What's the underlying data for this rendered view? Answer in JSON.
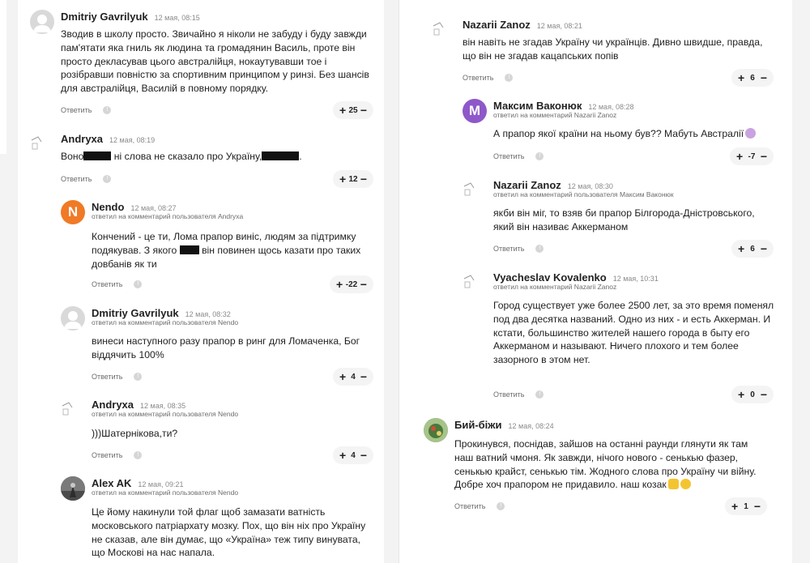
{
  "ui": {
    "reply_label": "Ответить"
  },
  "left": {
    "c1": {
      "author": "Dmitriy Gavrilyuk",
      "time": "12 мая, 08:15",
      "text": "Зводив в школу просто. Звичайно  я ніколи не забуду і буду завжди пам'ятати яка гниль як людина та громадянин Василь, проте він просто декласував цього австралійця, нокаутувавши тое і розібравши повністю за спортивним принципом у ринзі. Без шансів для австралійця, Василій в повному порядку.",
      "score": "25"
    },
    "c2": {
      "author": "Andryxa",
      "time": "12 мая, 08:19",
      "text_a": "Воно",
      "text_b": " ні слова не сказало про Україну,",
      "text_c": ".",
      "score": "12"
    },
    "c3": {
      "author": "Nendo",
      "time": "12 мая, 08:27",
      "reply_to": "ответил на комментарий пользователя Andryxa",
      "initial": "N",
      "text_a": "Кончений - це ти, Лома прапор виніс, людям за підтримку подякував. З якого ",
      "text_b": " він повинен щось казати про таких довбанів як ти",
      "score": "-22"
    },
    "c4": {
      "author": "Dmitriy Gavrilyuk",
      "time": "12 мая, 08:32",
      "reply_to": "ответил на комментарий пользователя Nendo",
      "text": "винеси наступного разу прапор в ринг для Ломаченка, Бог віддячить 100%",
      "score": "4"
    },
    "c5": {
      "author": "Andryxa",
      "time": "12 мая, 08:35",
      "reply_to": "ответил на комментарий пользователя Nendo",
      "text": ")))Шатернікова,ти?",
      "score": "4"
    },
    "c6": {
      "author": "Alex AK",
      "time": "12 мая, 09:21",
      "reply_to": "ответил на комментарий пользователя Nendo",
      "text": "Це йому накинули той флаг щоб замазати ватність московського патріархату мозку. Пох, що він ніх про Україну не сказав, але він думає, що «Україна» теж типу винувата, що Москові на нас напала."
    }
  },
  "right": {
    "r1": {
      "author": "Nazarii Zanoz",
      "time": "12 мая, 08:21",
      "text": "він навіть не згадав Україну чи українців. Дивно швидше, правда, що він не згадав кацапських попів",
      "score": "6"
    },
    "r2": {
      "author": "Максим Ваконюк",
      "time": "12 мая, 08:28",
      "reply_to": "ответил на комментарий Nazarii Zanoz",
      "initial": "М",
      "text": "А прапор якої країни на ньому був?? Мабуть Австралії",
      "score": "-7"
    },
    "r3": {
      "author": "Nazarii Zanoz",
      "time": "12 мая, 08:30",
      "reply_to": "ответил на комментарий пользователя Максим Ваконюк",
      "text": "якби він міг, то взяв би прапор Білгорода-Дністровського, який він називає Аккерманом",
      "score": "6"
    },
    "r4": {
      "author": "Vyacheslav Kovalenko",
      "time": "12 мая, 10:31",
      "reply_to": "ответил на комментарий Nazarii Zanoz",
      "text": "Город существует уже более 2500 лет, за это время поменял под два десятка названий. Одно из них - и есть Аккерман. И кстати, большинство жителей нашего города в быту его Аккерманом и называют.  Ничего плохого и тем более зазорного в этом нет.",
      "score": "0"
    },
    "r5": {
      "author": "Бий-біжи",
      "time": "12 мая, 08:24",
      "text": "Прокинувся, поснідав, зайшов на останні раунди глянути як там наш ватний чмоня. Як завжди, нічого нового - сенькью фазер, сенькью крайст, сенькью тім. Жодного слова про Україну чи війну. Добре хоч прапором не придавило. наш козак",
      "score": "1"
    }
  },
  "colors": {
    "nendo_avatar": "#f07a26",
    "maksym_avatar": "#8e58c9",
    "bg": "#f3f3f3"
  }
}
